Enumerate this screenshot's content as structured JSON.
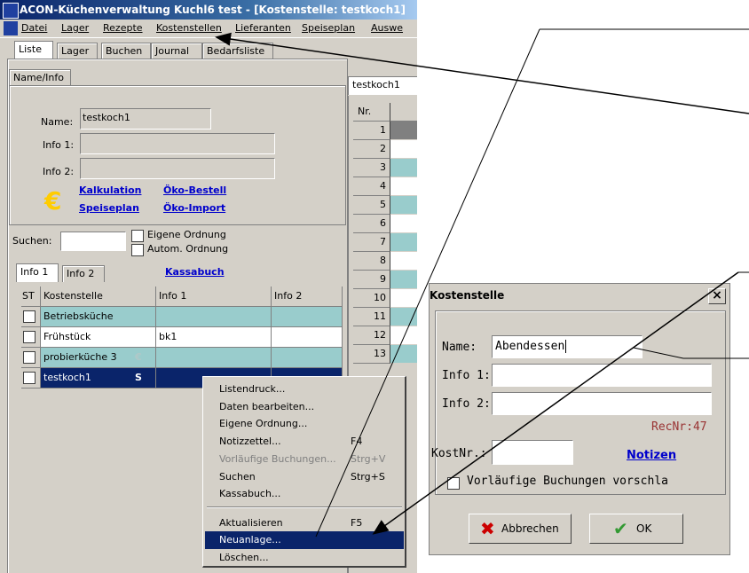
{
  "window": {
    "title": "ACON-Küchenverwaltung Kuchl6 test - [Kostenstelle: testkoch1]"
  },
  "menu": [
    "Datei",
    "Lager",
    "Rezepte",
    "Kostenstellen",
    "Lieferanten",
    "Speiseplan",
    "Auswe"
  ],
  "tabs": [
    "Liste",
    "Lager",
    "Buchen",
    "Journal",
    "Bedarfsliste"
  ],
  "info_tab": "Name/Info",
  "form": {
    "name_label": "Name:",
    "name_value": "testkoch1",
    "info1_label": "Info 1:",
    "info1_value": "",
    "info2_label": "Info 2:",
    "info2_value": "",
    "currency_symbol": "€",
    "links": [
      "Kalkulation",
      "Öko-Bestell",
      "Speiseplan",
      "Öko-Import"
    ]
  },
  "search": {
    "label": "Suchen:",
    "value": "",
    "opt1": "Eigene Ordnung",
    "opt2": "Autom. Ordnung"
  },
  "subtabs": [
    "Info 1",
    "Info 2"
  ],
  "kassabuch_link": "Kassabuch",
  "table": {
    "headers": [
      "ST",
      "Kostenstelle",
      "Info 1",
      "Info 2"
    ],
    "rows": [
      {
        "name": "Betriebsküche",
        "info1": "",
        "info2": "",
        "badge": "",
        "style": "teal"
      },
      {
        "name": "Frühstück",
        "info1": "bk1",
        "info2": "",
        "badge": "",
        "style": "white"
      },
      {
        "name": "probierküche 3",
        "info1": "",
        "info2": "",
        "badge": "€",
        "style": "teal"
      },
      {
        "name": "testkoch1",
        "info1": "",
        "info2": "",
        "badge": "S",
        "style": "selected"
      }
    ]
  },
  "right_panel": {
    "tab": "testkoch1",
    "header": "Nr.",
    "numbers": [
      "1",
      "2",
      "3",
      "4",
      "5",
      "6",
      "7",
      "8",
      "9",
      "10",
      "11",
      "12",
      "13"
    ]
  },
  "context_menu": [
    {
      "label": "Listendruck...",
      "shortcut": ""
    },
    {
      "label": "Daten bearbeiten...",
      "shortcut": ""
    },
    {
      "label": "Eigene Ordnung...",
      "shortcut": ""
    },
    {
      "label": "Notizzettel...",
      "shortcut": "F4"
    },
    {
      "label": "Vorläufige Buchungen...",
      "shortcut": "Strg+V",
      "disabled": true
    },
    {
      "label": "Suchen",
      "shortcut": "Strg+S"
    },
    {
      "label": "Kassabuch...",
      "shortcut": ""
    },
    {
      "label": "Aktualisieren",
      "shortcut": "F5"
    },
    {
      "label": "Neuanlage...",
      "shortcut": "",
      "highlighted": true
    },
    {
      "label": "Löschen...",
      "shortcut": ""
    }
  ],
  "dialog": {
    "title": "Kostenstelle",
    "close": "×",
    "name_label": "Name:",
    "name_value": "Abendessen",
    "info1_label": "Info 1:",
    "info1_value": "",
    "info2_label": "Info 2:",
    "info2_value": "",
    "recnr": "RecNr:47",
    "kostnr_label": "KostNr.:",
    "kostnr_value": "",
    "notizen_link": "Notizen",
    "checkbox_label": "Vorläufige Buchungen vorschla",
    "cancel_label": "Abbrechen",
    "ok_label": "OK"
  },
  "colors": {
    "teal_row": "#99cccc",
    "selection": "#0a246a",
    "link": "#0000cc",
    "euro": "#ffcc00",
    "cancel_x": "#cc0000",
    "ok_check": "#339933"
  }
}
